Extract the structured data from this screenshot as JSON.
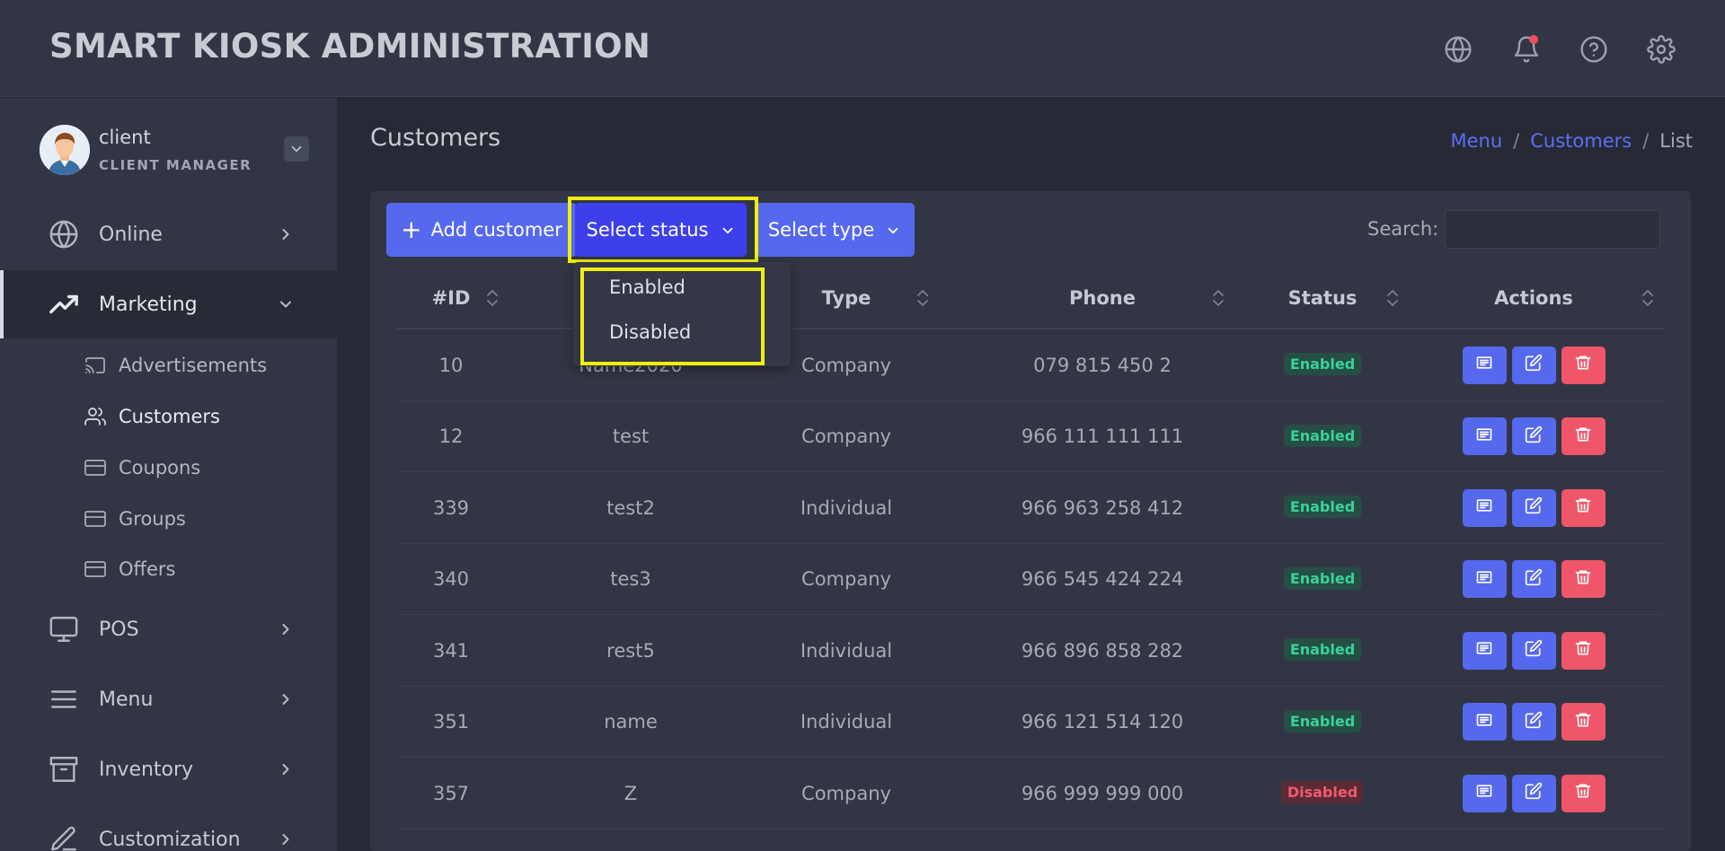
{
  "header": {
    "title": "SMART KIOSK ADMINISTRATION",
    "icons": [
      "globe-icon",
      "bell-icon",
      "help-icon",
      "gear-icon"
    ]
  },
  "user": {
    "name": "client",
    "role": "CLIENT MANAGER"
  },
  "sidebar": {
    "items": [
      {
        "label": "Online",
        "icon": "globe-icon"
      },
      {
        "label": "Marketing",
        "icon": "trending-up-icon",
        "expanded": true
      },
      {
        "label": "POS",
        "icon": "monitor-icon"
      },
      {
        "label": "Menu",
        "icon": "menu-icon"
      },
      {
        "label": "Inventory",
        "icon": "archive-icon"
      },
      {
        "label": "Customization",
        "icon": "pen-icon"
      }
    ],
    "marketing_sub": [
      {
        "label": "Advertisements",
        "icon": "cast-icon"
      },
      {
        "label": "Customers",
        "icon": "users-icon",
        "current": true
      },
      {
        "label": "Coupons",
        "icon": "card-icon"
      },
      {
        "label": "Groups",
        "icon": "card-icon"
      },
      {
        "label": "Offers",
        "icon": "card-icon"
      }
    ]
  },
  "page": {
    "title": "Customers",
    "breadcrumb": [
      "Menu",
      "Customers",
      "List"
    ]
  },
  "toolbar": {
    "add_label": "Add customer",
    "status_label": "Select status",
    "type_label": "Select type",
    "search_label": "Search:",
    "search_value": ""
  },
  "status_dropdown": {
    "options": [
      "Enabled",
      "Disabled"
    ]
  },
  "table": {
    "columns": [
      "#ID",
      "Type",
      "Phone",
      "Status",
      "Actions"
    ],
    "rows": [
      {
        "id": "10",
        "name": "Name2020",
        "type": "Company",
        "phone": "079 815 450 2",
        "status": "Enabled"
      },
      {
        "id": "12",
        "name": "test",
        "type": "Company",
        "phone": "966 111 111 111",
        "status": "Enabled"
      },
      {
        "id": "339",
        "name": "test2",
        "type": "Individual",
        "phone": "966 963 258 412",
        "status": "Enabled"
      },
      {
        "id": "340",
        "name": "tes3",
        "type": "Company",
        "phone": "966 545 424 224",
        "status": "Enabled"
      },
      {
        "id": "341",
        "name": "rest5",
        "type": "Individual",
        "phone": "966 896 858 282",
        "status": "Enabled"
      },
      {
        "id": "351",
        "name": "name",
        "type": "Individual",
        "phone": "966 121 514 120",
        "status": "Enabled"
      },
      {
        "id": "357",
        "name": "Z",
        "type": "Company",
        "phone": "966 999 999 000",
        "status": "Disabled"
      }
    ]
  },
  "colors": {
    "accent": "#5668ee",
    "accent_active": "#3d40ea",
    "danger": "#f05669",
    "success": "#3ad29a",
    "highlight": "#f1ee0f"
  }
}
